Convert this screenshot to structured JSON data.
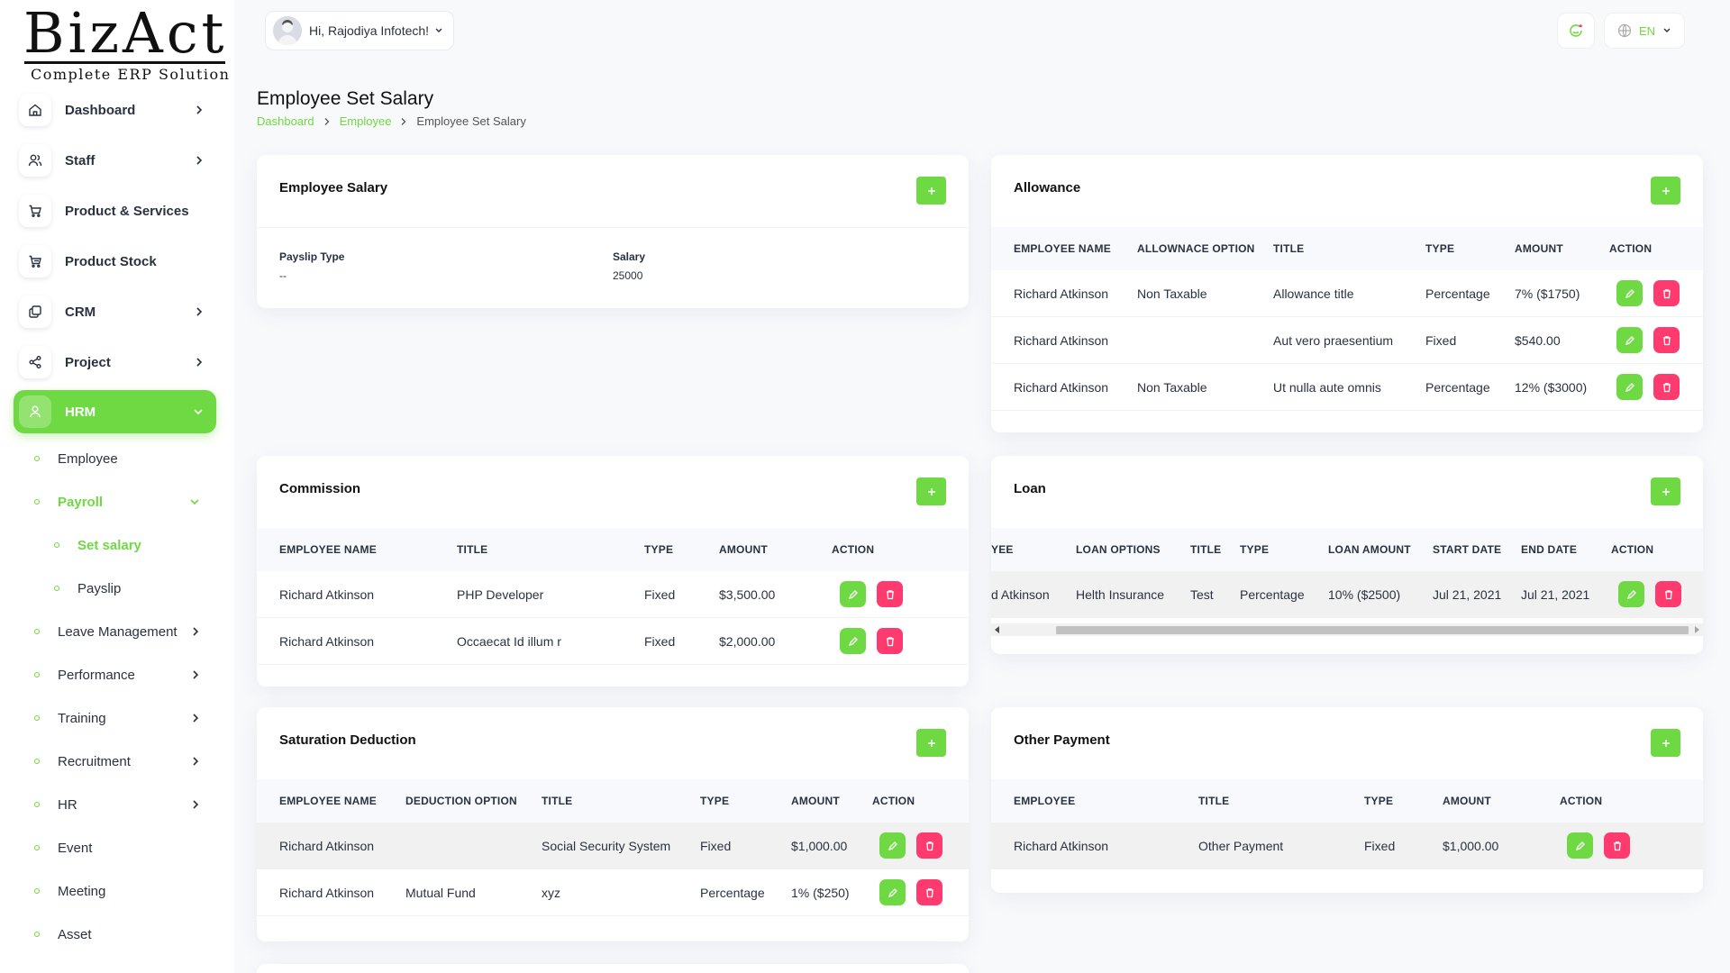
{
  "brand": {
    "name": "BizAct",
    "tagline": "Complete ERP Solution"
  },
  "header": {
    "greeting": "Hi, Rajodiya Infotech!",
    "language": "EN"
  },
  "sidebar": {
    "items": [
      {
        "label": "Dashboard",
        "icon": "home-icon"
      },
      {
        "label": "Staff",
        "icon": "users-icon"
      },
      {
        "label": "Product & Services",
        "icon": "cart-icon"
      },
      {
        "label": "Product Stock",
        "icon": "cart-stock-icon"
      },
      {
        "label": "CRM",
        "icon": "layers-icon"
      },
      {
        "label": "Project",
        "icon": "share-icon"
      },
      {
        "label": "HRM",
        "icon": "user-icon"
      }
    ],
    "hrm_items": [
      {
        "label": "Employee"
      },
      {
        "label": "Payroll"
      },
      {
        "label": "Set salary"
      },
      {
        "label": "Payslip"
      },
      {
        "label": "Leave Management"
      },
      {
        "label": "Performance"
      },
      {
        "label": "Training"
      },
      {
        "label": "Recruitment"
      },
      {
        "label": "HR"
      },
      {
        "label": "Event"
      },
      {
        "label": "Meeting"
      },
      {
        "label": "Asset"
      }
    ]
  },
  "page": {
    "title": "Employee Set Salary",
    "breadcrumb": [
      "Dashboard",
      "Employee",
      "Employee Set Salary"
    ]
  },
  "employee_salary": {
    "title": "Employee Salary",
    "payslip_type_label": "Payslip Type",
    "payslip_type_value": "--",
    "salary_label": "Salary",
    "salary_value": "25000"
  },
  "allowance": {
    "title": "Allowance",
    "columns": [
      "EMPLOYEE NAME",
      "ALLOWNACE OPTION",
      "TITLE",
      "TYPE",
      "AMOUNT",
      "ACTION"
    ],
    "rows": [
      [
        "Richard Atkinson",
        "Non Taxable",
        "Allowance title",
        "Percentage",
        "7% ($1750)"
      ],
      [
        "Richard Atkinson",
        "",
        "Aut vero praesentium",
        "Fixed",
        "$540.00"
      ],
      [
        "Richard Atkinson",
        "Non Taxable",
        "Ut nulla aute omnis",
        "Percentage",
        "12% ($3000)"
      ]
    ]
  },
  "commission": {
    "title": "Commission",
    "columns": [
      "EMPLOYEE NAME",
      "TITLE",
      "TYPE",
      "AMOUNT",
      "ACTION"
    ],
    "rows": [
      [
        "Richard Atkinson",
        "PHP Developer",
        "Fixed",
        "$3,500.00"
      ],
      [
        "Richard Atkinson",
        "Occaecat Id illum r",
        "Fixed",
        "$2,000.00"
      ]
    ]
  },
  "loan": {
    "title": "Loan",
    "columns": [
      "YEE",
      "LOAN OPTIONS",
      "TITLE",
      "TYPE",
      "LOAN AMOUNT",
      "START DATE",
      "END DATE",
      "ACTION"
    ],
    "rows": [
      [
        "d Atkinson",
        "Helth Insurance",
        "Test",
        "Percentage",
        "10% ($2500)",
        "Jul 21, 2021",
        "Jul 21, 2021"
      ]
    ]
  },
  "saturation_deduction": {
    "title": "Saturation Deduction",
    "columns": [
      "EMPLOYEE NAME",
      "DEDUCTION OPTION",
      "TITLE",
      "TYPE",
      "AMOUNT",
      "ACTION"
    ],
    "rows": [
      [
        "Richard Atkinson",
        "",
        "Social Security System",
        "Fixed",
        "$1,000.00"
      ],
      [
        "Richard Atkinson",
        "Mutual Fund",
        "xyz",
        "Percentage",
        "1% ($250)"
      ]
    ]
  },
  "other_payment": {
    "title": "Other Payment",
    "columns": [
      "EMPLOYEE",
      "TITLE",
      "TYPE",
      "AMOUNT",
      "ACTION"
    ],
    "rows": [
      [
        "Richard Atkinson",
        "Other Payment",
        "Fixed",
        "$1,000.00"
      ]
    ]
  },
  "colors": {
    "accent": "#6fd943",
    "danger": "#ff3a6e",
    "text": "#293240"
  }
}
